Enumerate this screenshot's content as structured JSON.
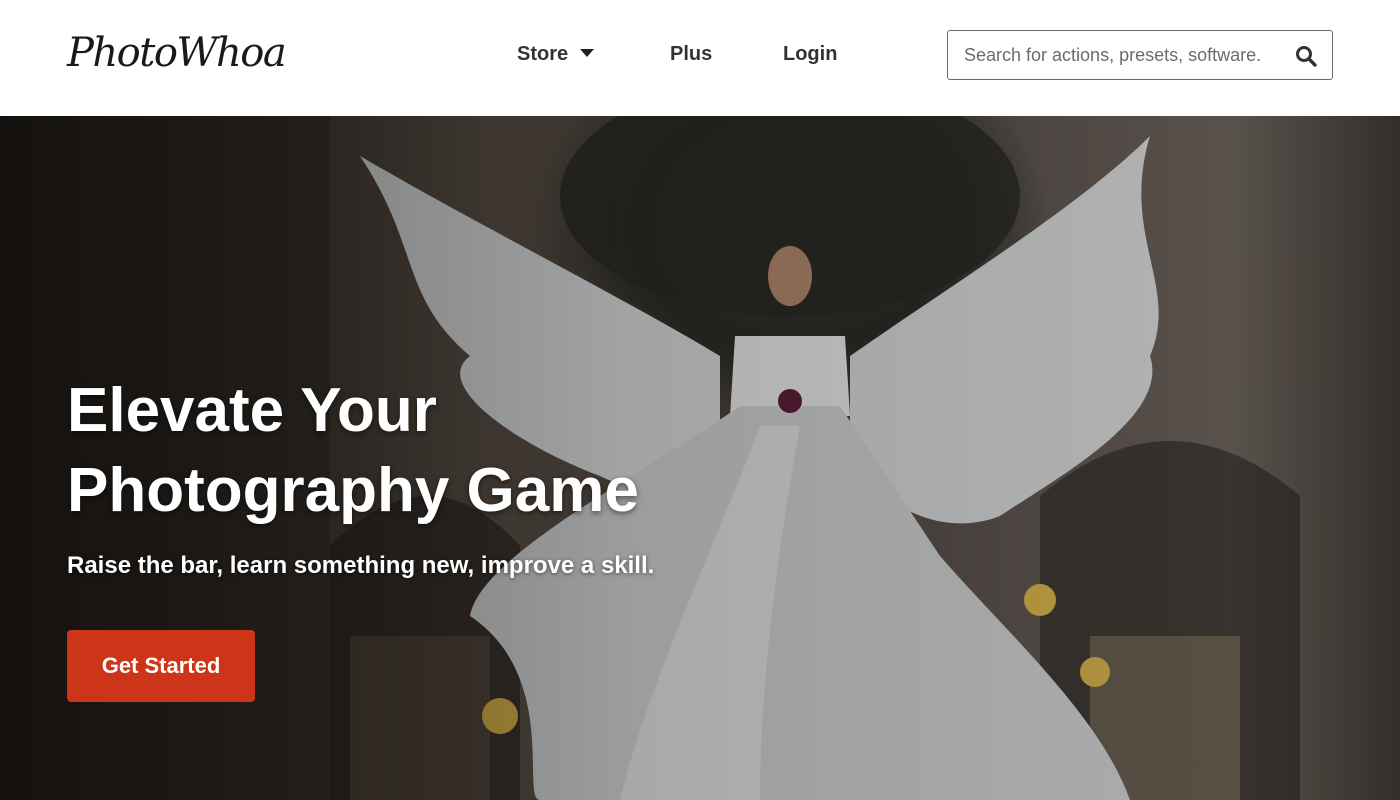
{
  "header": {
    "logo_text": "PhotoWhoa",
    "nav": {
      "store_label": "Store",
      "plus_label": "Plus",
      "login_label": "Login"
    },
    "search": {
      "placeholder": "Search for actions, presets, software."
    }
  },
  "hero": {
    "title": "Elevate Your Photography Game",
    "subtitle": "Raise the bar, learn something new, improve a skill.",
    "cta_label": "Get Started"
  },
  "colors": {
    "cta": "#cc3517",
    "nav_text": "#333333",
    "header_bg": "#ffffff"
  },
  "icons": {
    "store_dropdown": "chevron-down-icon",
    "search": "search-icon"
  }
}
